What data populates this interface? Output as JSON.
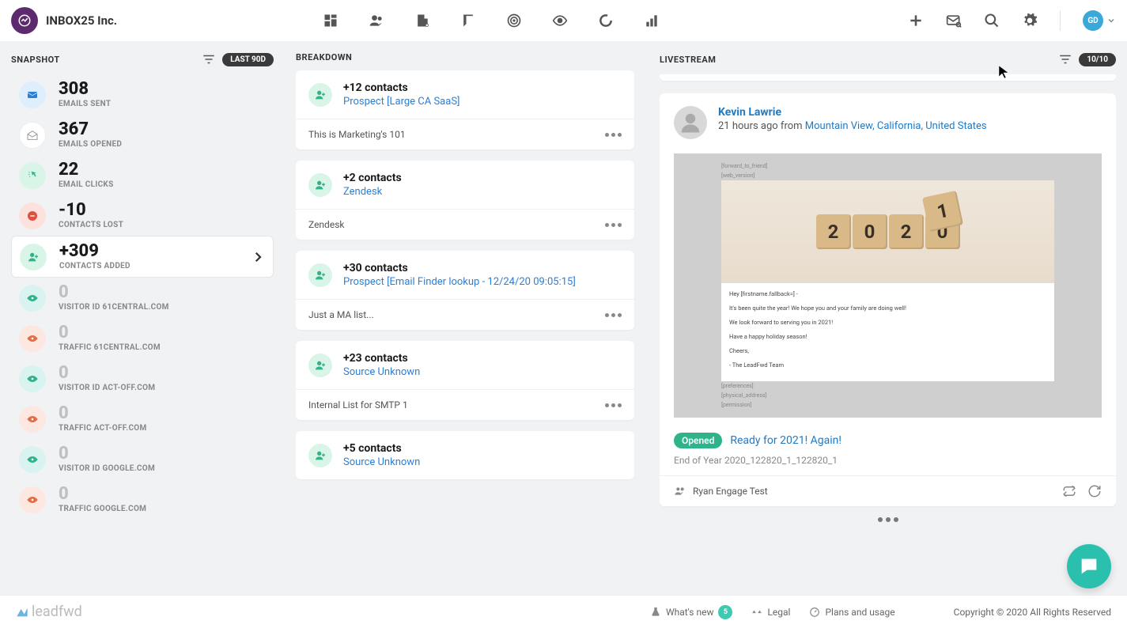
{
  "header": {
    "company": "INBOX25 Inc.",
    "avatar_initials": "GD"
  },
  "snapshot": {
    "title": "SNAPSHOT",
    "range_pill": "LAST 90D",
    "items": [
      {
        "value": "308",
        "label": "EMAILS SENT",
        "muted": false,
        "iconClass": "ic-blue",
        "icon": "mail"
      },
      {
        "value": "367",
        "label": "EMAILS OPENED",
        "muted": false,
        "iconClass": "ic-white",
        "icon": "open"
      },
      {
        "value": "22",
        "label": "EMAIL CLICKS",
        "muted": false,
        "iconClass": "ic-green",
        "icon": "click"
      },
      {
        "value": "-10",
        "label": "CONTACTS LOST",
        "muted": false,
        "iconClass": "ic-red",
        "icon": "lost"
      },
      {
        "value": "+309",
        "label": "CONTACTS ADDED",
        "muted": false,
        "iconClass": "ic-teal",
        "icon": "add",
        "selected": true
      },
      {
        "value": "0",
        "label": "VISITOR ID 61CENTRAL.COM",
        "muted": true,
        "iconClass": "ic-eye-teal",
        "icon": "eye"
      },
      {
        "value": "0",
        "label": "TRAFFIC 61CENTRAL.COM",
        "muted": true,
        "iconClass": "ic-eye-red",
        "icon": "eye"
      },
      {
        "value": "0",
        "label": "VISITOR ID ACT-OFF.COM",
        "muted": true,
        "iconClass": "ic-eye-teal",
        "icon": "eye"
      },
      {
        "value": "0",
        "label": "TRAFFIC ACT-OFF.COM",
        "muted": true,
        "iconClass": "ic-eye-red",
        "icon": "eye"
      },
      {
        "value": "0",
        "label": "VISITOR ID GOOGLE.COM",
        "muted": true,
        "iconClass": "ic-eye-teal",
        "icon": "eye"
      },
      {
        "value": "0",
        "label": "TRAFFIC GOOGLE.COM",
        "muted": true,
        "iconClass": "ic-eye-red",
        "icon": "eye"
      }
    ]
  },
  "breakdown": {
    "title": "BREAKDOWN",
    "cards": [
      {
        "title": "+12 contacts",
        "link": "Prospect [Large CA SaaS]",
        "note": "This is Marketing's 101"
      },
      {
        "title": "+2 contacts",
        "link": "Zendesk",
        "note": "Zendesk"
      },
      {
        "title": "+30 contacts",
        "link": "Prospect [Email Finder lookup - 12/24/20 09:05:15]",
        "note": "Just a MA list..."
      },
      {
        "title": "+23 contacts",
        "link": "Source Unknown",
        "note": "Internal List for SMTP 1"
      },
      {
        "title": "+5 contacts",
        "link": "Source Unknown",
        "note": ""
      }
    ]
  },
  "livestream": {
    "title": "LIVESTREAM",
    "count_pill": "10/10",
    "feed": {
      "name": "Kevin Lawrie",
      "time": "21 hours ago from ",
      "location": "Mountain View, California, United States",
      "preview_top_1": "[forward_to_friend]",
      "preview_top_2": "[web_version]",
      "year_blocks": [
        "2",
        "0",
        "2",
        "0",
        "1"
      ],
      "body_lines": [
        "Hey [firstname.fallback=] -",
        "It's been quite the year! We hope you and your family are doing well!",
        "We look forward to serving you in 2021!",
        "Have a happy holiday season!",
        "Cheers,",
        " - The LeadFwd Team"
      ],
      "preview_bot_1": "[preferences]",
      "preview_bot_2": "[physical_address]",
      "preview_bot_3": "[permission]",
      "badge": "Opened",
      "subject": "Ready for 2021! Again!",
      "campaign_id": "End of Year 2020_122820_1_122820_1",
      "footer_user": "Ryan Engage Test"
    }
  },
  "footer": {
    "logo": "leadfwd",
    "whats_new": "What's new",
    "whats_new_count": "5",
    "legal": "Legal",
    "plans": "Plans and usage",
    "copyright": "Copyright © 2020 All Rights Reserved"
  }
}
